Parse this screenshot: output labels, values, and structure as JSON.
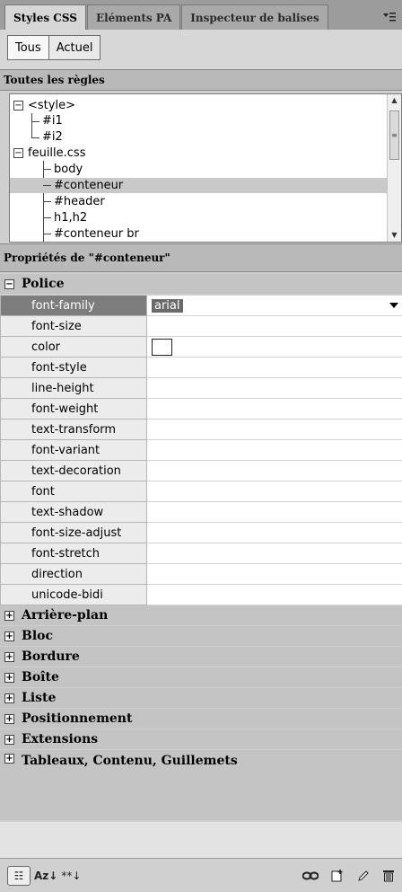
{
  "tabs": [
    {
      "label": "Styles CSS",
      "active": true
    },
    {
      "label": "Eléments PA",
      "active": false
    },
    {
      "label": "Inspecteur de balises",
      "active": false
    }
  ],
  "tab_menu_icon": "panel-menu-icon",
  "mode_buttons": {
    "all": "Tous",
    "current": "Actuel"
  },
  "rules_header": "Toutes les règles",
  "rules_tree": {
    "style_node": "<style>",
    "style_children": [
      "#i1",
      "#i2"
    ],
    "sheet_node": "feuille.css",
    "sheet_children": [
      "body",
      "#conteneur",
      "#header",
      "h1,h2",
      "#conteneur br"
    ],
    "selected": "#conteneur"
  },
  "properties_header": "Propriétés de \"#conteneur\"",
  "groups": {
    "police": "Police",
    "collapsed": [
      "Arrière-plan",
      "Bloc",
      "Bordure",
      "Boîte",
      "Liste",
      "Positionnement",
      "Extensions",
      "Tableaux, Contenu, Guillemets"
    ]
  },
  "properties": [
    {
      "name": "font-family",
      "value": "arial"
    },
    {
      "name": "font-size",
      "value": ""
    },
    {
      "name": "color",
      "value": ""
    },
    {
      "name": "font-style",
      "value": ""
    },
    {
      "name": "line-height",
      "value": ""
    },
    {
      "name": "font-weight",
      "value": ""
    },
    {
      "name": "text-transform",
      "value": ""
    },
    {
      "name": "font-variant",
      "value": ""
    },
    {
      "name": "text-decoration",
      "value": ""
    },
    {
      "name": "font",
      "value": ""
    },
    {
      "name": "text-shadow",
      "value": ""
    },
    {
      "name": "font-size-adjust",
      "value": ""
    },
    {
      "name": "font-stretch",
      "value": ""
    },
    {
      "name": "direction",
      "value": ""
    },
    {
      "name": "unicode-bidi",
      "value": ""
    }
  ],
  "toolbar": {
    "category_view": "☷",
    "alpha_view": "Az↓",
    "set_only": "**↓",
    "icons": [
      "attach-stylesheet-icon",
      "new-rule-icon",
      "edit-rule-icon",
      "delete-rule-icon"
    ]
  }
}
